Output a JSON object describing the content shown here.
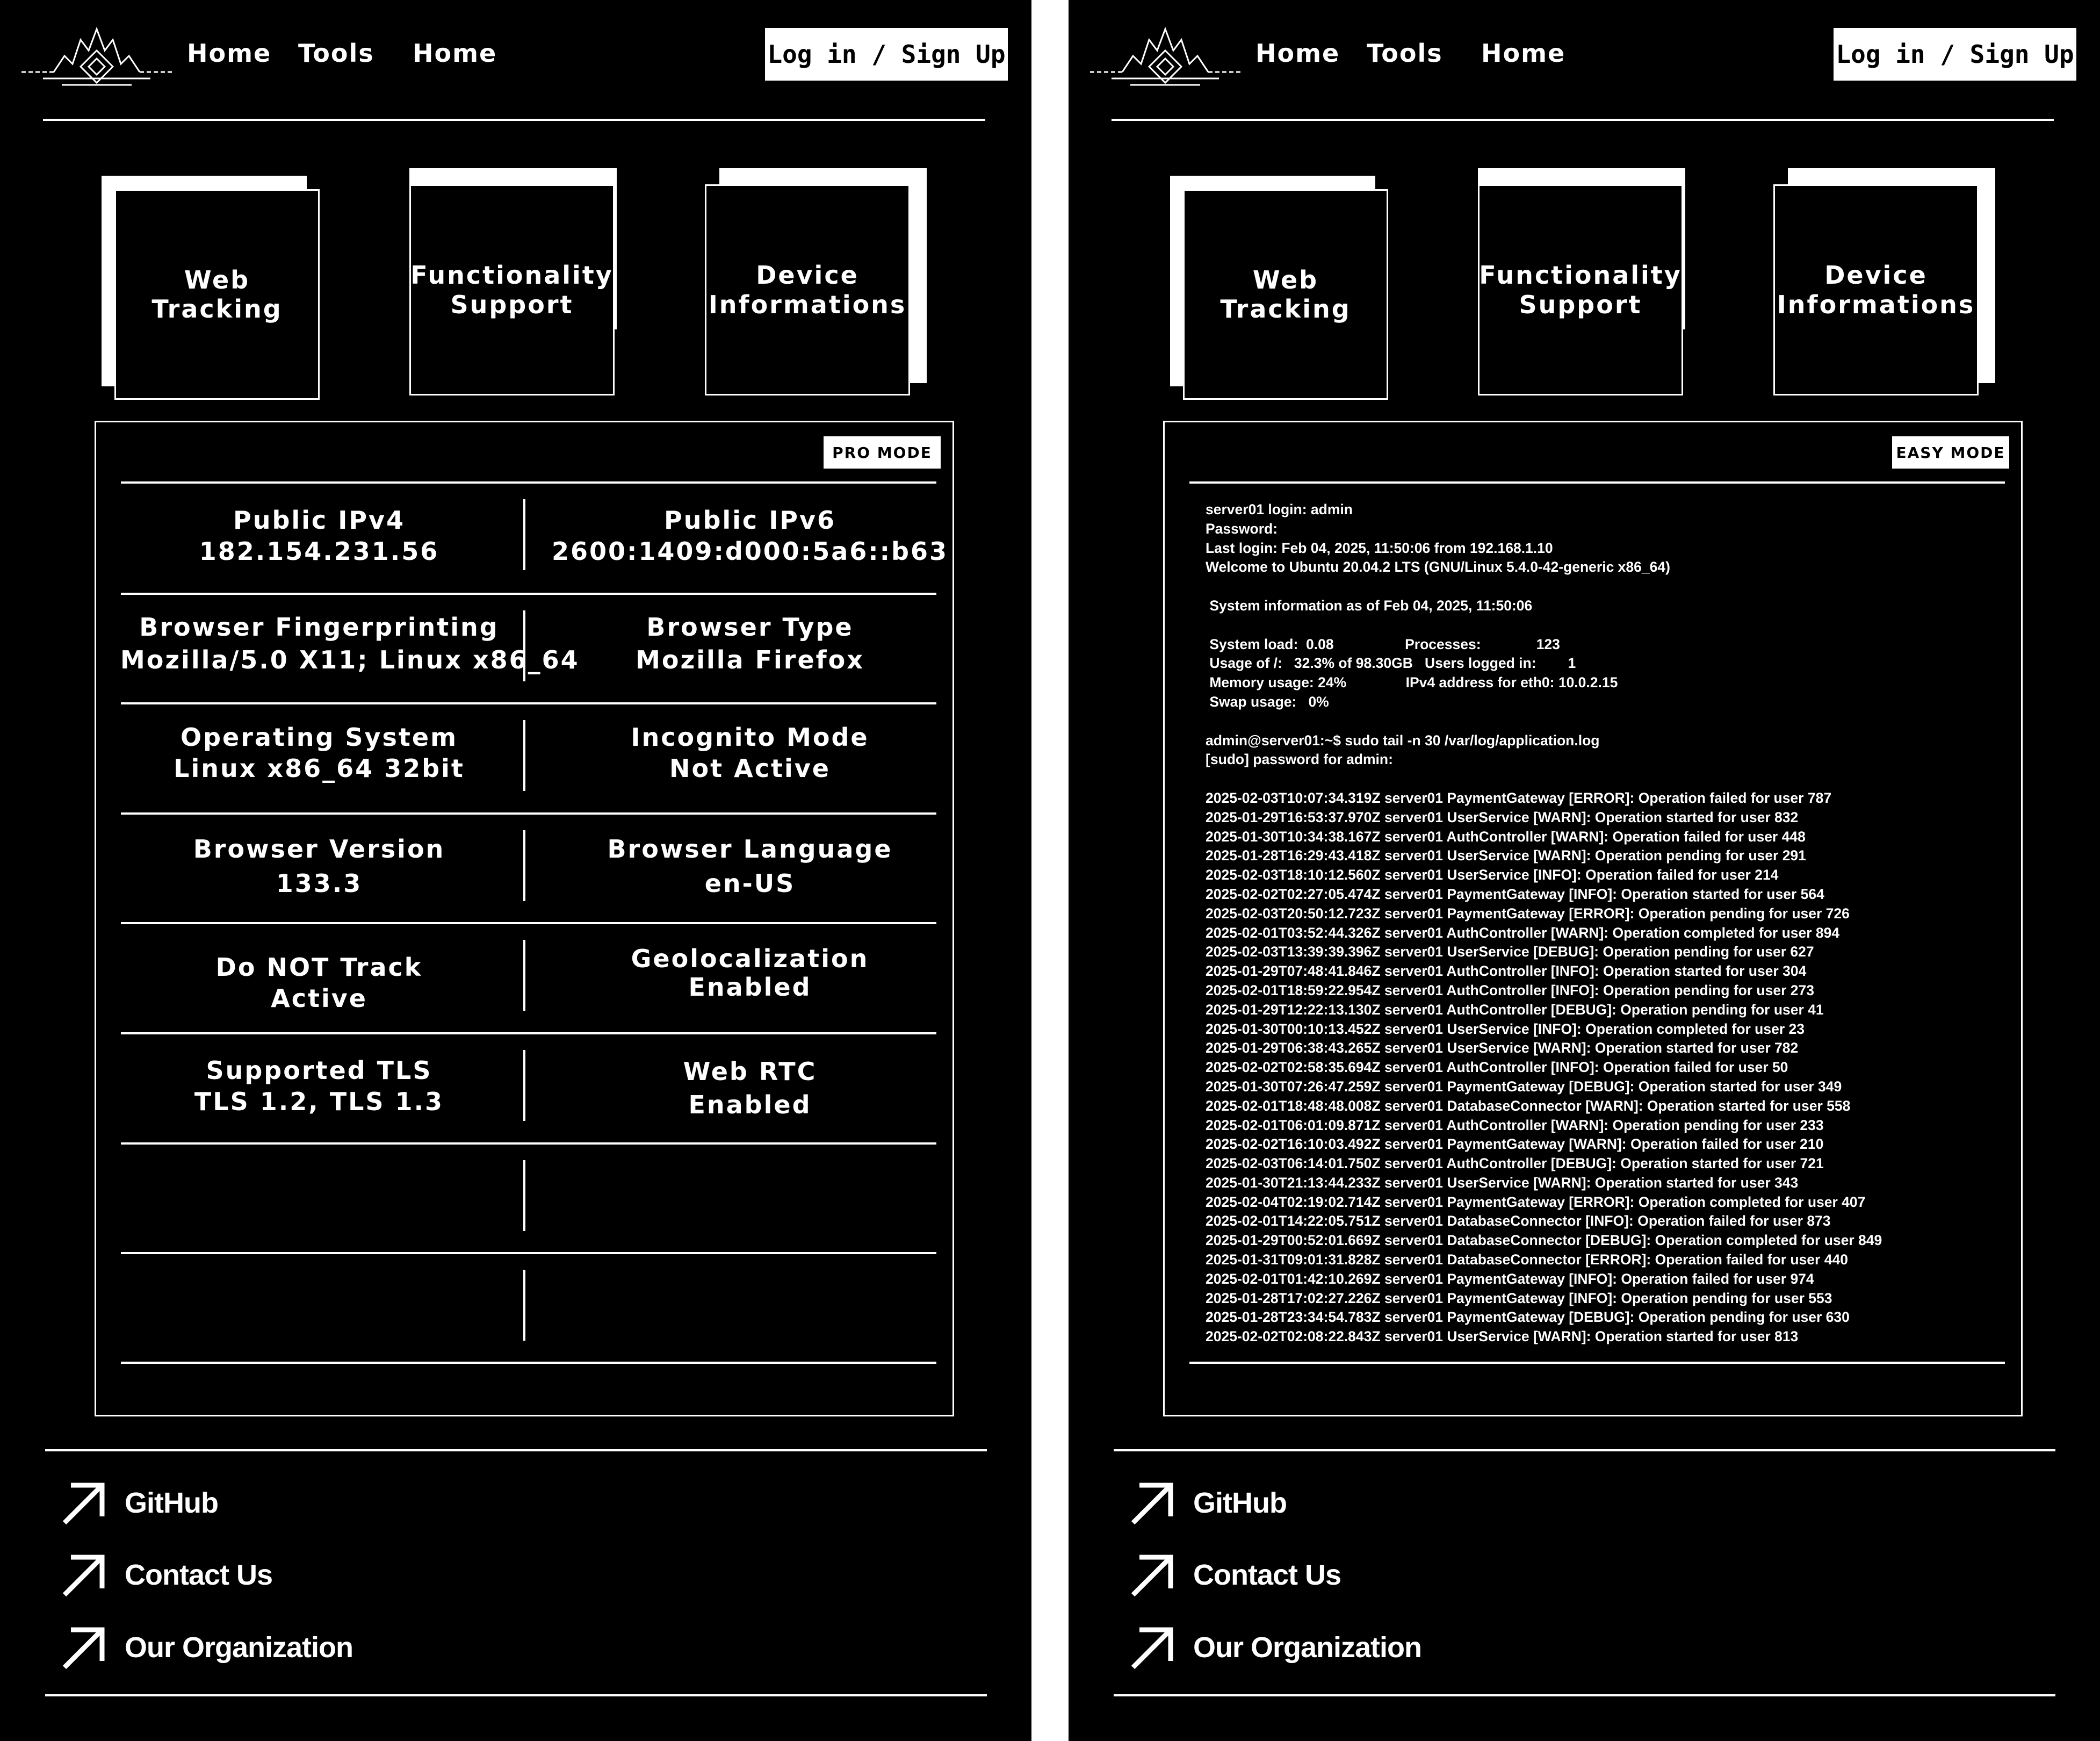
{
  "nav": {
    "items": [
      "Home",
      "Tools",
      "Home"
    ],
    "login_label": "Log in / Sign Up"
  },
  "cards": [
    "Web\nTracking",
    "Functionality\nSupport",
    "Device\nInformations"
  ],
  "left": {
    "mode_label": "PRO MODE",
    "rows": [
      [
        {
          "label": "Public IPv4",
          "value": "182.154.231.56"
        },
        {
          "label": "Public IPv6",
          "value": "2600:1409:d000:5a6::b63"
        }
      ],
      [
        {
          "label": "Browser Fingerprinting",
          "value": "Mozilla/5.0 X11; Linux x86_64"
        },
        {
          "label": "Browser Type",
          "value": "Mozilla Firefox"
        }
      ],
      [
        {
          "label": "Operating System",
          "value": "Linux x86_64 32bit"
        },
        {
          "label": "Incognito Mode",
          "value": "Not Active"
        }
      ],
      [
        {
          "label": "Browser Version",
          "value": "133.3"
        },
        {
          "label": "Browser Language",
          "value": "en-US"
        }
      ],
      [
        {
          "label": "Do NOT Track",
          "value": "Active"
        },
        {
          "label": "Geolocalization",
          "value": "Enabled"
        }
      ],
      [
        {
          "label": "Supported TLS",
          "value": "TLS 1.2, TLS 1.3"
        },
        {
          "label": "Web RTC",
          "value": "Enabled"
        }
      ],
      [
        {
          "label": "",
          "value": ""
        },
        {
          "label": "",
          "value": ""
        }
      ],
      [
        {
          "label": "",
          "value": ""
        },
        {
          "label": "",
          "value": ""
        }
      ]
    ]
  },
  "right": {
    "mode_label": "EASY MODE",
    "terminal_lines": [
      "server01 login: admin",
      "Password:",
      "Last login: Feb 04, 2025, 11:50:06 from 192.168.1.10",
      "Welcome to Ubuntu 20.04.2 LTS (GNU/Linux 5.4.0-42-generic x86_64)",
      "",
      " System information as of Feb 04, 2025, 11:50:06",
      "",
      " System load:  0.08                  Processes:              123",
      " Usage of /:   32.3% of 98.30GB   Users logged in:        1",
      " Memory usage: 24%               IPv4 address for eth0: 10.0.2.15",
      " Swap usage:   0%",
      "",
      "admin@server01:~$ sudo tail -n 30 /var/log/application.log",
      "[sudo] password for admin:",
      "",
      "2025-02-03T10:07:34.319Z server01 PaymentGateway [ERROR]: Operation failed for user 787",
      "2025-01-29T16:53:37.970Z server01 UserService [WARN]: Operation started for user 832",
      "2025-01-30T10:34:38.167Z server01 AuthController [WARN]: Operation failed for user 448",
      "2025-01-28T16:29:43.418Z server01 UserService [WARN]: Operation pending for user 291",
      "2025-02-03T18:10:12.560Z server01 UserService [INFO]: Operation failed for user 214",
      "2025-02-02T02:27:05.474Z server01 PaymentGateway [INFO]: Operation started for user 564",
      "2025-02-03T20:50:12.723Z server01 PaymentGateway [ERROR]: Operation pending for user 726",
      "2025-02-01T03:52:44.326Z server01 AuthController [WARN]: Operation completed for user 894",
      "2025-02-03T13:39:39.396Z server01 UserService [DEBUG]: Operation pending for user 627",
      "2025-01-29T07:48:41.846Z server01 AuthController [INFO]: Operation started for user 304",
      "2025-02-01T18:59:22.954Z server01 AuthController [INFO]: Operation pending for user 273",
      "2025-01-29T12:22:13.130Z server01 AuthController [DEBUG]: Operation pending for user 41",
      "2025-01-30T00:10:13.452Z server01 UserService [INFO]: Operation completed for user 23",
      "2025-01-29T06:38:43.265Z server01 UserService [WARN]: Operation started for user 782",
      "2025-02-02T02:58:35.694Z server01 AuthController [INFO]: Operation failed for user 50",
      "2025-01-30T07:26:47.259Z server01 PaymentGateway [DEBUG]: Operation started for user 349",
      "2025-02-01T18:48:48.008Z server01 DatabaseConnector [WARN]: Operation started for user 558",
      "2025-02-01T06:01:09.871Z server01 AuthController [WARN]: Operation pending for user 233",
      "2025-02-02T16:10:03.492Z server01 PaymentGateway [WARN]: Operation failed for user 210",
      "2025-02-03T06:14:01.750Z server01 AuthController [DEBUG]: Operation started for user 721",
      "2025-01-30T21:13:44.233Z server01 UserService [WARN]: Operation started for user 343",
      "2025-02-04T02:19:02.714Z server01 PaymentGateway [ERROR]: Operation completed for user 407",
      "2025-02-01T14:22:05.751Z server01 DatabaseConnector [INFO]: Operation failed for user 873",
      "2025-01-29T00:52:01.669Z server01 DatabaseConnector [DEBUG]: Operation completed for user 849",
      "2025-01-31T09:01:31.828Z server01 DatabaseConnector [ERROR]: Operation failed for user 440",
      "2025-02-01T01:42:10.269Z server01 PaymentGateway [INFO]: Operation failed for user 974",
      "2025-01-28T17:02:27.226Z server01 PaymentGateway [INFO]: Operation pending for user 553",
      "2025-01-28T23:34:54.783Z server01 PaymentGateway [DEBUG]: Operation pending for user 630",
      "2025-02-02T02:08:22.843Z server01 UserService [WARN]: Operation started for user 813"
    ]
  },
  "footer": {
    "links": [
      "GitHub",
      "Contact Us",
      "Our Organization"
    ]
  },
  "colors": {
    "background": "#000000",
    "foreground": "#ffffff",
    "separator": "#ffffff"
  },
  "icons": {
    "logo": "mountain-diamond-logo",
    "link": "arrow-up-right-icon"
  }
}
